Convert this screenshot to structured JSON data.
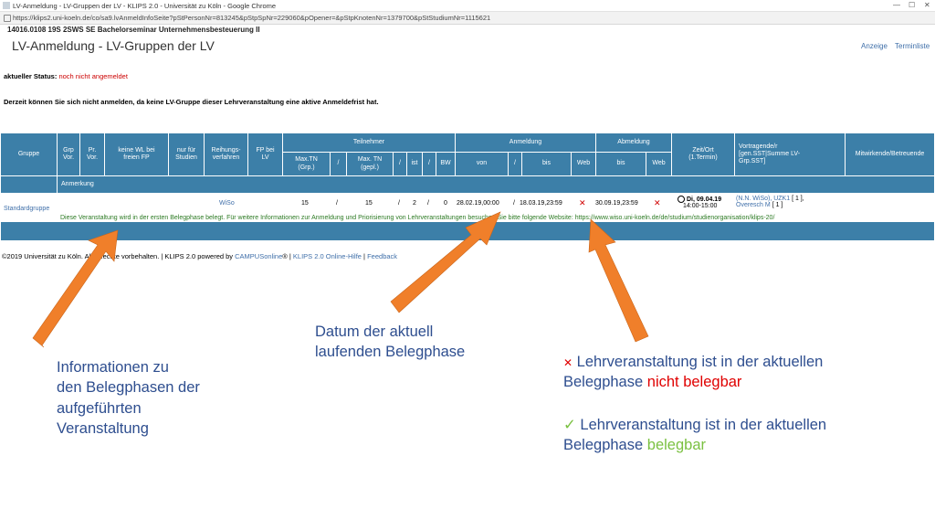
{
  "browser": {
    "window_title": "LV-Anmeldung - LV-Gruppen der LV - KLIPS 2.0 - Universität zu Köln - Google Chrome",
    "url": "https://klips2.uni-koeln.de/co/sa9.lvAnmeldInfoSeite?pStPersonNr=813245&pStpSpNr=229060&pOpener=&pStpKnotenNr=1379700&pStStudiumNr=1115621",
    "controls": {
      "minimize": "—",
      "maximize": "☐",
      "close": "✕"
    }
  },
  "page": {
    "course_header": "14016.0108 19S 2SWS SE Bachelorseminar Unternehmensbesteuerung II",
    "title": "LV-Anmeldung - LV-Gruppen der LV",
    "links": {
      "anzeige": "Anzeige",
      "terminliste": "Terminliste"
    },
    "status_label": "aktueller Status:",
    "status_value": "noch nicht angemeldet",
    "notice": "Derzeit können Sie sich nicht anmelden, da keine LV-Gruppe dieser Lehrveranstaltung eine aktive Anmeldefrist hat."
  },
  "table": {
    "headers": {
      "gruppe": "Gruppe",
      "grp_vor": [
        "Grp",
        "Vor."
      ],
      "pr_vor": [
        "Pr.",
        "Vor."
      ],
      "keine_wl": [
        "keine WL bei",
        "freien FP"
      ],
      "nur_fuer": [
        "nur für",
        "Studien"
      ],
      "reihung": [
        "Reihungs-",
        "verfahren"
      ],
      "fp_bei_lv": [
        "FP bei",
        "LV"
      ],
      "teilnehmer": "Teilnehmer",
      "max_tn_grp": [
        "Max.TN",
        "(Grp.)"
      ],
      "slash": "/",
      "max_tn_gepl": [
        "Max. TN",
        "(gepl.)"
      ],
      "ist": "ist",
      "bw": "BW",
      "anmeldung": "Anmeldung",
      "von": "von",
      "bis": "bis",
      "web": "Web",
      "abmeldung": "Abmeldung",
      "zeit_ort": [
        "Zeit/Ort",
        "(1.Termin)"
      ],
      "vortragende": [
        "Vortragende/r",
        "[gen.SST|Summe LV-",
        "Grp.SST]"
      ],
      "mitwirkende": "Mitwirkende/Betreuende",
      "anmerkung": "Anmerkung"
    },
    "row": {
      "gruppe": "Standardgruppe",
      "reihung": "WiSo",
      "max_tn_grp": "15",
      "max_tn_gepl": "15",
      "ist": "2",
      "bw": "0",
      "anm_von": "28.02.19,00:00",
      "anm_bis": "18.03.19,23:59",
      "anm_web": "✕",
      "abm_bis": "30.09.19,23:59",
      "abm_web": "✕",
      "zeit_date": "Di, 09.04.19",
      "zeit_time": "14:00-15:00",
      "vortragende_1": "(N.N. WiSo), UZK1",
      "vortragende_1_count": "[ 1 ],",
      "vortragende_2": "Overesch M",
      "vortragende_2_count": "[ 1 ]",
      "anmerkung": "Diese Veranstaltung wird in der ersten Belegphase belegt. Für weitere Informationen zur Anmeldung und Priorisierung von Lehrveranstaltungen besuchen Sie bitte folgende Website: https://www.wiso.uni-koeln.de/de/studium/studienorganisation/klips-20/"
    }
  },
  "footer": {
    "copyright": "©2019 Universität zu Köln. Alle Rechte vorbehalten. | KLIPS 2.0 powered by",
    "campusonline": "CAMPUSonline",
    "reg": "® |",
    "hilfe": "KLIPS 2.0 Online-Hilfe",
    "sep": "|",
    "feedback": "Feedback"
  },
  "annotations": {
    "info_lines": [
      "Informationen zu",
      "den Belegphasen der",
      "aufgeführten",
      "Veranstaltung"
    ],
    "datum_lines": [
      "Datum der aktuell",
      "laufenden Belegphase"
    ],
    "x_symbol": "✕",
    "x_line1": "Lehrveranstaltung ist in der aktuellen",
    "x_line2_prefix": "Belegphase",
    "x_line2_highlight": "nicht belegbar",
    "check_symbol": "✓",
    "check_line1": "Lehrveranstaltung ist in der aktuellen",
    "check_line2_prefix": "Belegphase",
    "check_line2_highlight": "belegbar"
  },
  "colors": {
    "table_header": "#3c7fa8",
    "arrow": "#f07f2a",
    "annotation_text": "#2e4e8f",
    "red": "#e00000",
    "green": "#7bc142"
  }
}
